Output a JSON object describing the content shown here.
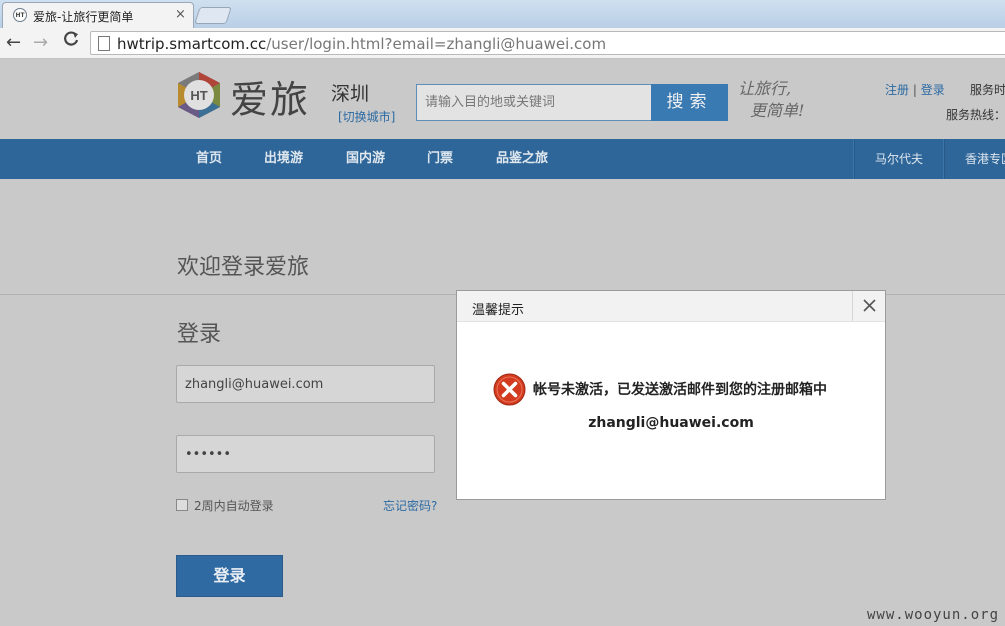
{
  "browser": {
    "tab_title": "爱旅-让旅行更简单",
    "tab_close": "×",
    "favicon_text": "HT",
    "url_host": "hwtrip.smartcom.cc",
    "url_path": "/user/login.html?email=zhangli@huawei.com",
    "back_glyph": "←",
    "forward_glyph": "→",
    "reload_glyph": "C"
  },
  "header": {
    "logo_badge": "HT",
    "logo_text": "爱旅",
    "city": "深圳",
    "switch_city": "[切换城市]",
    "search_placeholder": "请输入目的地或关键词",
    "search_button": "搜索",
    "slogan_line1": "让旅行,",
    "slogan_line2": "更简单!",
    "register": "注册",
    "separator": "|",
    "login": "登录",
    "service_time": "服务时",
    "hotline": "服务热线："
  },
  "nav": {
    "items": [
      "首页",
      "出境游",
      "国内游",
      "门票",
      "品鉴之旅"
    ],
    "right_items": [
      "马尔代夫",
      "香港专区"
    ]
  },
  "login_page": {
    "welcome": "欢迎登录爱旅",
    "heading": "登录",
    "email_value": "zhangli@huawei.com",
    "password_value": "••••••",
    "remember_label": "2周内自动登录",
    "forgot_label": "忘记密码?",
    "submit_label": "登录"
  },
  "dialog": {
    "title": "温馨提示",
    "message": "帐号未激活，已发送激活邮件到您的注册邮箱中",
    "email": "zhangli@huawei.com"
  },
  "watermark": "www.wooyun.org",
  "colors": {
    "brand_blue": "#2e6699",
    "error_red": "#d33a1e",
    "link_blue": "#2c6aa3"
  }
}
